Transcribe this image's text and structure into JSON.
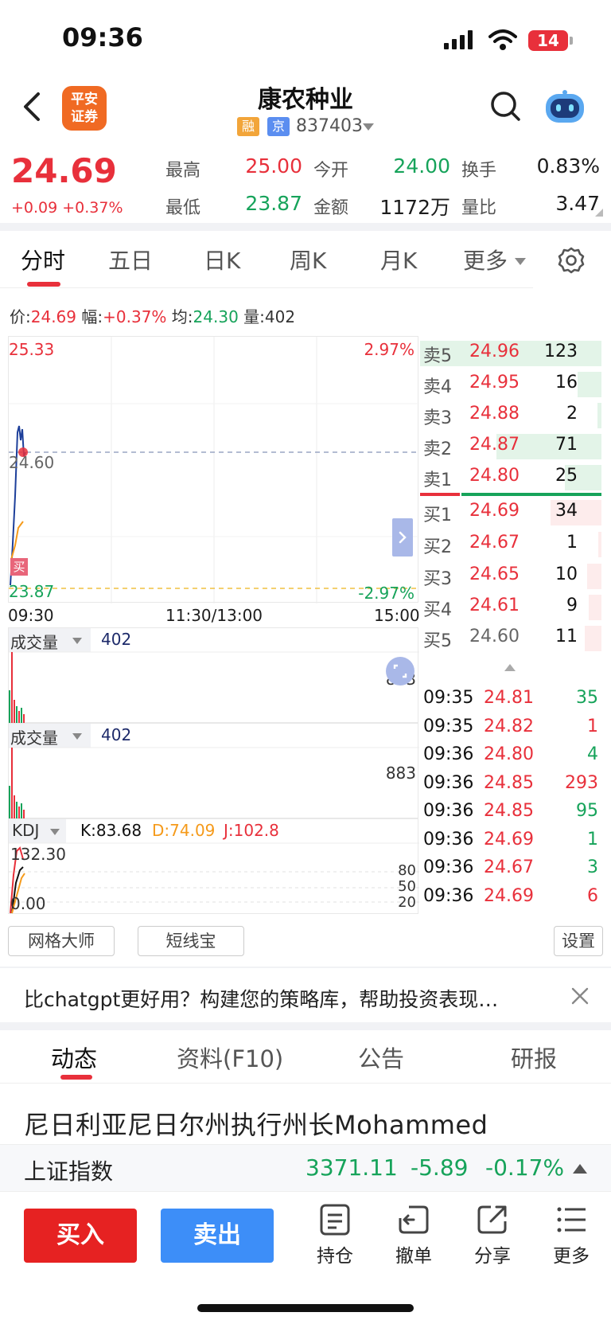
{
  "status_bar": {
    "time": "09:36",
    "battery": "14"
  },
  "header": {
    "broker_logo_line1": "平安",
    "broker_logo_line2": "证券",
    "stock_name": "康农种业",
    "tag_rong": "融",
    "tag_jing": "京",
    "stock_code": "837403"
  },
  "quote": {
    "price": "24.69",
    "change": "+0.09 +0.37%",
    "fields": [
      {
        "label": "最高",
        "value": "25.00"
      },
      {
        "label": "今开",
        "value": "24.00"
      },
      {
        "label": "换手",
        "value": "0.83%"
      },
      {
        "label": "最低",
        "value": "23.87"
      },
      {
        "label": "金额",
        "value": "1172万"
      },
      {
        "label": "量比",
        "value": "3.47"
      }
    ]
  },
  "chart_tabs": [
    "分时",
    "五日",
    "日K",
    "周K",
    "月K",
    "更多"
  ],
  "info_line": {
    "price_label": "价:",
    "price": "24.69",
    "range_label": "幅:",
    "range": "+0.37%",
    "avg_label": "均:",
    "avg": "24.30",
    "vol_label": "量:",
    "vol": "402"
  },
  "intraday": {
    "y_max": "25.33",
    "y_mid": "24.60",
    "y_min": "23.87",
    "pct_max": "2.97%",
    "pct_min": "-2.97%",
    "x_start": "09:30",
    "x_mid": "11:30/13:00",
    "x_end": "15:00",
    "buy_marker": "买"
  },
  "volume_panel_1": {
    "label": "成交量",
    "value": "402",
    "max": "883"
  },
  "volume_panel_2": {
    "label": "成交量",
    "value": "402",
    "max": "883"
  },
  "kdj_panel": {
    "label": "KDJ",
    "k": "K:83.68",
    "d": "D:74.09",
    "j": "J:102.8",
    "y_top": "132.30",
    "y_bottom": "0.00",
    "level_80": "80",
    "level_50": "50",
    "level_20": "20"
  },
  "order_book": {
    "asks": [
      {
        "label": "卖5",
        "price": "24.96",
        "vol": "123",
        "depth": 1.0
      },
      {
        "label": "卖4",
        "price": "24.95",
        "vol": "16",
        "depth": 0.13
      },
      {
        "label": "卖3",
        "price": "24.88",
        "vol": "2",
        "depth": 0.02
      },
      {
        "label": "卖2",
        "price": "24.87",
        "vol": "71",
        "depth": 0.58
      },
      {
        "label": "卖1",
        "price": "24.80",
        "vol": "25",
        "depth": 0.2
      }
    ],
    "bids": [
      {
        "label": "买1",
        "price": "24.69",
        "vol": "34",
        "depth": 0.28
      },
      {
        "label": "买2",
        "price": "24.67",
        "vol": "1",
        "depth": 0.01
      },
      {
        "label": "买3",
        "price": "24.65",
        "vol": "10",
        "depth": 0.08
      },
      {
        "label": "买4",
        "price": "24.61",
        "vol": "9",
        "depth": 0.07
      },
      {
        "label": "买5",
        "price": "24.60",
        "vol": "11",
        "depth": 0.09
      }
    ]
  },
  "ticks": [
    {
      "time": "09:35",
      "price": "24.81",
      "vol": "35",
      "side": "green"
    },
    {
      "time": "09:35",
      "price": "24.82",
      "vol": "1",
      "side": "red"
    },
    {
      "time": "09:36",
      "price": "24.80",
      "vol": "4",
      "side": "green"
    },
    {
      "time": "09:36",
      "price": "24.85",
      "vol": "293",
      "side": "red"
    },
    {
      "time": "09:36",
      "price": "24.85",
      "vol": "95",
      "side": "green"
    },
    {
      "time": "09:36",
      "price": "24.69",
      "vol": "1",
      "side": "green"
    },
    {
      "time": "09:36",
      "price": "24.67",
      "vol": "3",
      "side": "green"
    },
    {
      "time": "09:36",
      "price": "24.69",
      "vol": "6",
      "side": "red"
    }
  ],
  "tools": {
    "grid_master": "网格大师",
    "short_line": "短线宝",
    "settings": "设置"
  },
  "ad": {
    "text": "比chatgpt更好用？构建您的策略库，帮助投资表现…"
  },
  "news_tabs": [
    "动态",
    "资料(F10)",
    "公告",
    "研报"
  ],
  "news_headline": "尼日利亚尼日尔州执行州长Mohammed",
  "index": {
    "name": "上证指数",
    "value": "3371.11",
    "change": "-5.89",
    "pct": "-0.17%"
  },
  "bottom_bar": {
    "buy": "买入",
    "sell": "卖出",
    "items": [
      {
        "label": "持仓",
        "icon": "holdings-icon"
      },
      {
        "label": "撤单",
        "icon": "cancel-order-icon"
      },
      {
        "label": "分享",
        "icon": "share-icon"
      },
      {
        "label": "更多",
        "icon": "menu-icon"
      }
    ]
  },
  "colors": {
    "up": "#e8303b",
    "down": "#16a35a",
    "accent_blue": "#3d8ef8",
    "broker_orange": "#f06a23"
  }
}
